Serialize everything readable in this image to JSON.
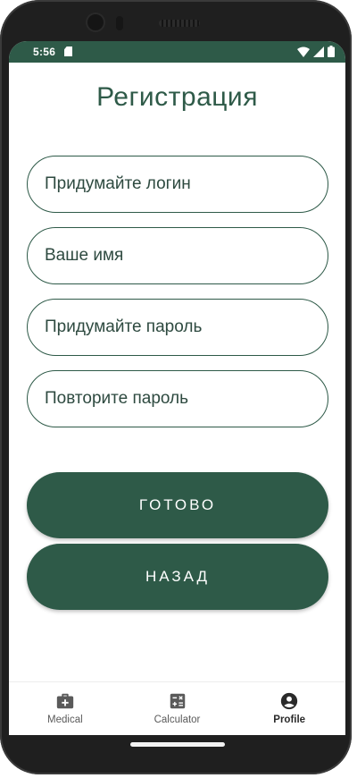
{
  "status_bar": {
    "time": "5:56",
    "icons": [
      "sd-card-icon",
      "wifi-icon",
      "signal-icon",
      "battery-icon"
    ],
    "background": "#2e5a48"
  },
  "title": "Регистрация",
  "form": {
    "login_placeholder": "Придумайте логин",
    "name_placeholder": "Ваше имя",
    "password_placeholder": "Придумайте пароль",
    "repeat_password_placeholder": "Повторите пароль"
  },
  "buttons": {
    "done_label": "ГОТОВО",
    "back_label": "НАЗАД"
  },
  "bottom_nav": {
    "items": [
      {
        "label": "Medical",
        "icon": "medical-kit-icon",
        "active": false
      },
      {
        "label": "Calculator",
        "icon": "calculator-icon",
        "active": false
      },
      {
        "label": "Profile",
        "icon": "profile-icon",
        "active": true
      }
    ]
  },
  "colors": {
    "accent": "#2e5a48",
    "text": "#2e4a40"
  }
}
